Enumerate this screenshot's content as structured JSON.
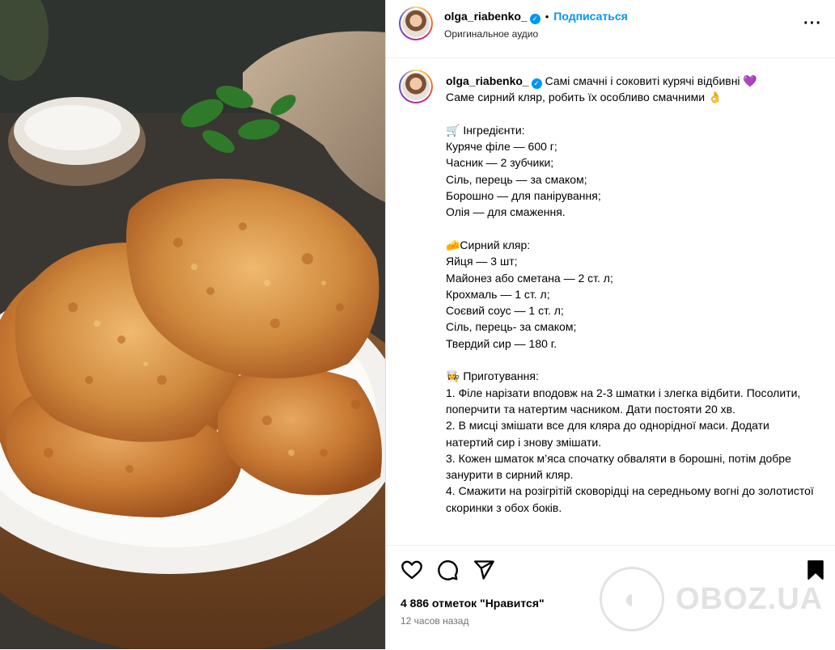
{
  "post": {
    "username": "olga_riabenko_",
    "verified_icon": "verified-badge-icon",
    "separator": "•",
    "follow_label": "Подписаться",
    "audio": "Оригинальное аудио",
    "more_icon": "more-options-icon"
  },
  "caption": {
    "username": "olga_riabenko_",
    "text": " Самі смачні і соковиті курячі відбивні 💜\nСаме сирний кляр, робить їх особливо смачними 👌\n\n🛒 Інгредієнти:\nКуряче філе — 600 г;\nЧасник — 2 зубчики;\nСіль, перець — за смаком;\nБорошно — для панірування;\nОлія — для смаження.\n\n🧀Сирний кляр:\nЯйця — 3 шт;\nМайонез або сметана — 2 ст. л;\nКрохмаль — 1 ст. л;\nСоєвий соус — 1 ст. л;\nСіль, перець- за смаком;\nТвердий сир — 180 г.\n\n👩‍🍳 Приготування:\n1. Філе нарізати вподовж на 2-3 шматки і злегка відбити. Посолити, поперчити та натертим часником. Дати постояти 20 хв.\n2. В мисці змішати все для кляра до однорідної маси. Додати натертий сир і знову змішати.\n3. Кожен шматок м’яса спочатку обваляти в борошні, потім добре занурити в сирний кляр.\n4. Смажити на розігрітій сковорідці на середньому вогні до золотистої скоринки з обох боків."
  },
  "actions": {
    "like_icon": "heart-icon",
    "comment_icon": "comment-icon",
    "share_icon": "share-icon",
    "save_icon": "bookmark-icon",
    "likes": "4 886 отметок \"Нравится\"",
    "time": "12 часов назад"
  },
  "watermark": {
    "text": "OBOZ.UA"
  },
  "colors": {
    "accent": "#0095f6",
    "border": "#efefef",
    "muted": "#737373"
  }
}
